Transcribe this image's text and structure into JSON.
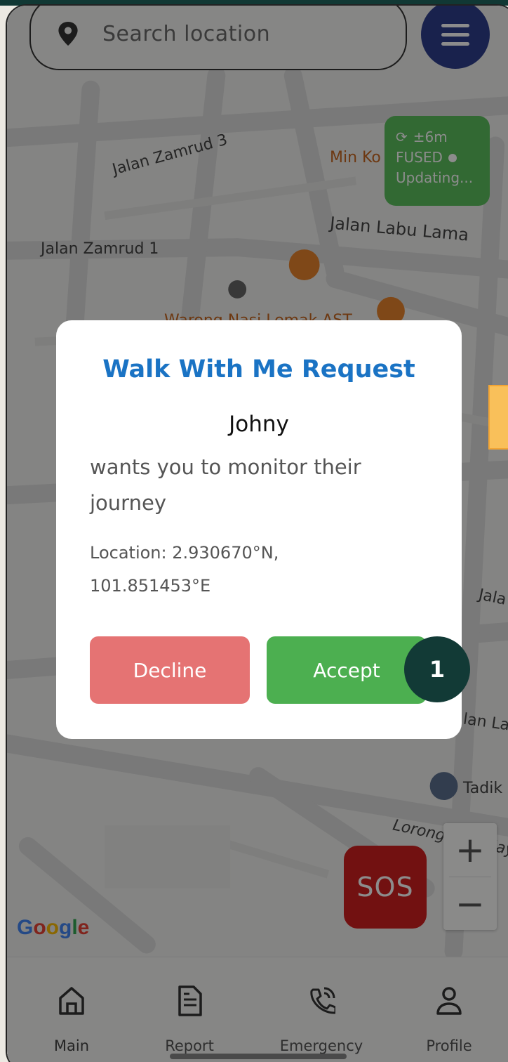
{
  "search": {
    "placeholder": "Search location",
    "pin_icon": "map-pin-icon"
  },
  "menu": {
    "icon": "hamburger-menu-icon"
  },
  "gps_status": {
    "accuracy": "±6m",
    "mode": "FUSED",
    "state": "Updating..."
  },
  "map_labels": {
    "zamrud3": "Jalan Zamrud 3",
    "zamrud1": "Jalan Zamrud 1",
    "labu_lama": "Jalan Labu Lama",
    "min_ko": "Min Ko",
    "warong": "Warong Nasi Lemak AST",
    "jala": "Jala",
    "lan_la": "lan La",
    "tadik": "Tadik",
    "lorong": "Lorong Labu Jaya"
  },
  "google_logo": "Google",
  "zoom": {
    "in": "+",
    "out": "−"
  },
  "sos": {
    "label": "SOS"
  },
  "nav": {
    "items": [
      {
        "label": "Main",
        "icon": "home-icon"
      },
      {
        "label": "Report",
        "icon": "document-icon"
      },
      {
        "label": "Emergency",
        "icon": "phone-call-icon"
      },
      {
        "label": "Profile",
        "icon": "user-icon"
      }
    ]
  },
  "dialog": {
    "title": "Walk With Me Request",
    "name": "Johny",
    "message": "wants you to monitor their journey",
    "location_line1": "Location: 2.930670°N,",
    "location_line2": "101.851453°E",
    "decline_label": "Decline",
    "accept_label": "Accept"
  },
  "step_badge": "1",
  "colors": {
    "title": "#1a73c4",
    "decline": "#e57373",
    "accept": "#4caf50",
    "sos": "#d01f1f",
    "menu": "#2f3f8c",
    "badge": "#123a36",
    "gps": "#5bbf5e"
  }
}
